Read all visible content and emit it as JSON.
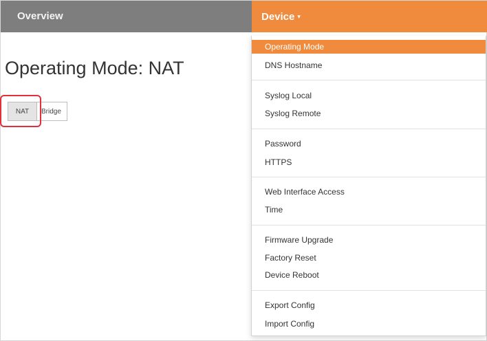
{
  "nav": {
    "overview_label": "Overview",
    "device_label": "Device",
    "device_caret": "▾"
  },
  "main": {
    "page_title": "Operating Mode: NAT",
    "mode_options": [
      "NAT",
      "Bridge"
    ],
    "selected_mode": "NAT"
  },
  "dropdown": {
    "groups": [
      [
        "Operating Mode",
        "DNS Hostname"
      ],
      [
        "Syslog Local",
        "Syslog Remote"
      ],
      [
        "Password",
        "HTTPS"
      ],
      [
        "Web Interface Access",
        "Time"
      ],
      [
        "Firmware Upgrade",
        "Factory Reset",
        "Device Reboot"
      ],
      [
        "Export Config",
        "Import Config"
      ]
    ],
    "selected_item": "Operating Mode"
  },
  "colors": {
    "accent": "#f08a3c",
    "topbar": "#7e7e7e",
    "highlight": "#e0303a"
  }
}
